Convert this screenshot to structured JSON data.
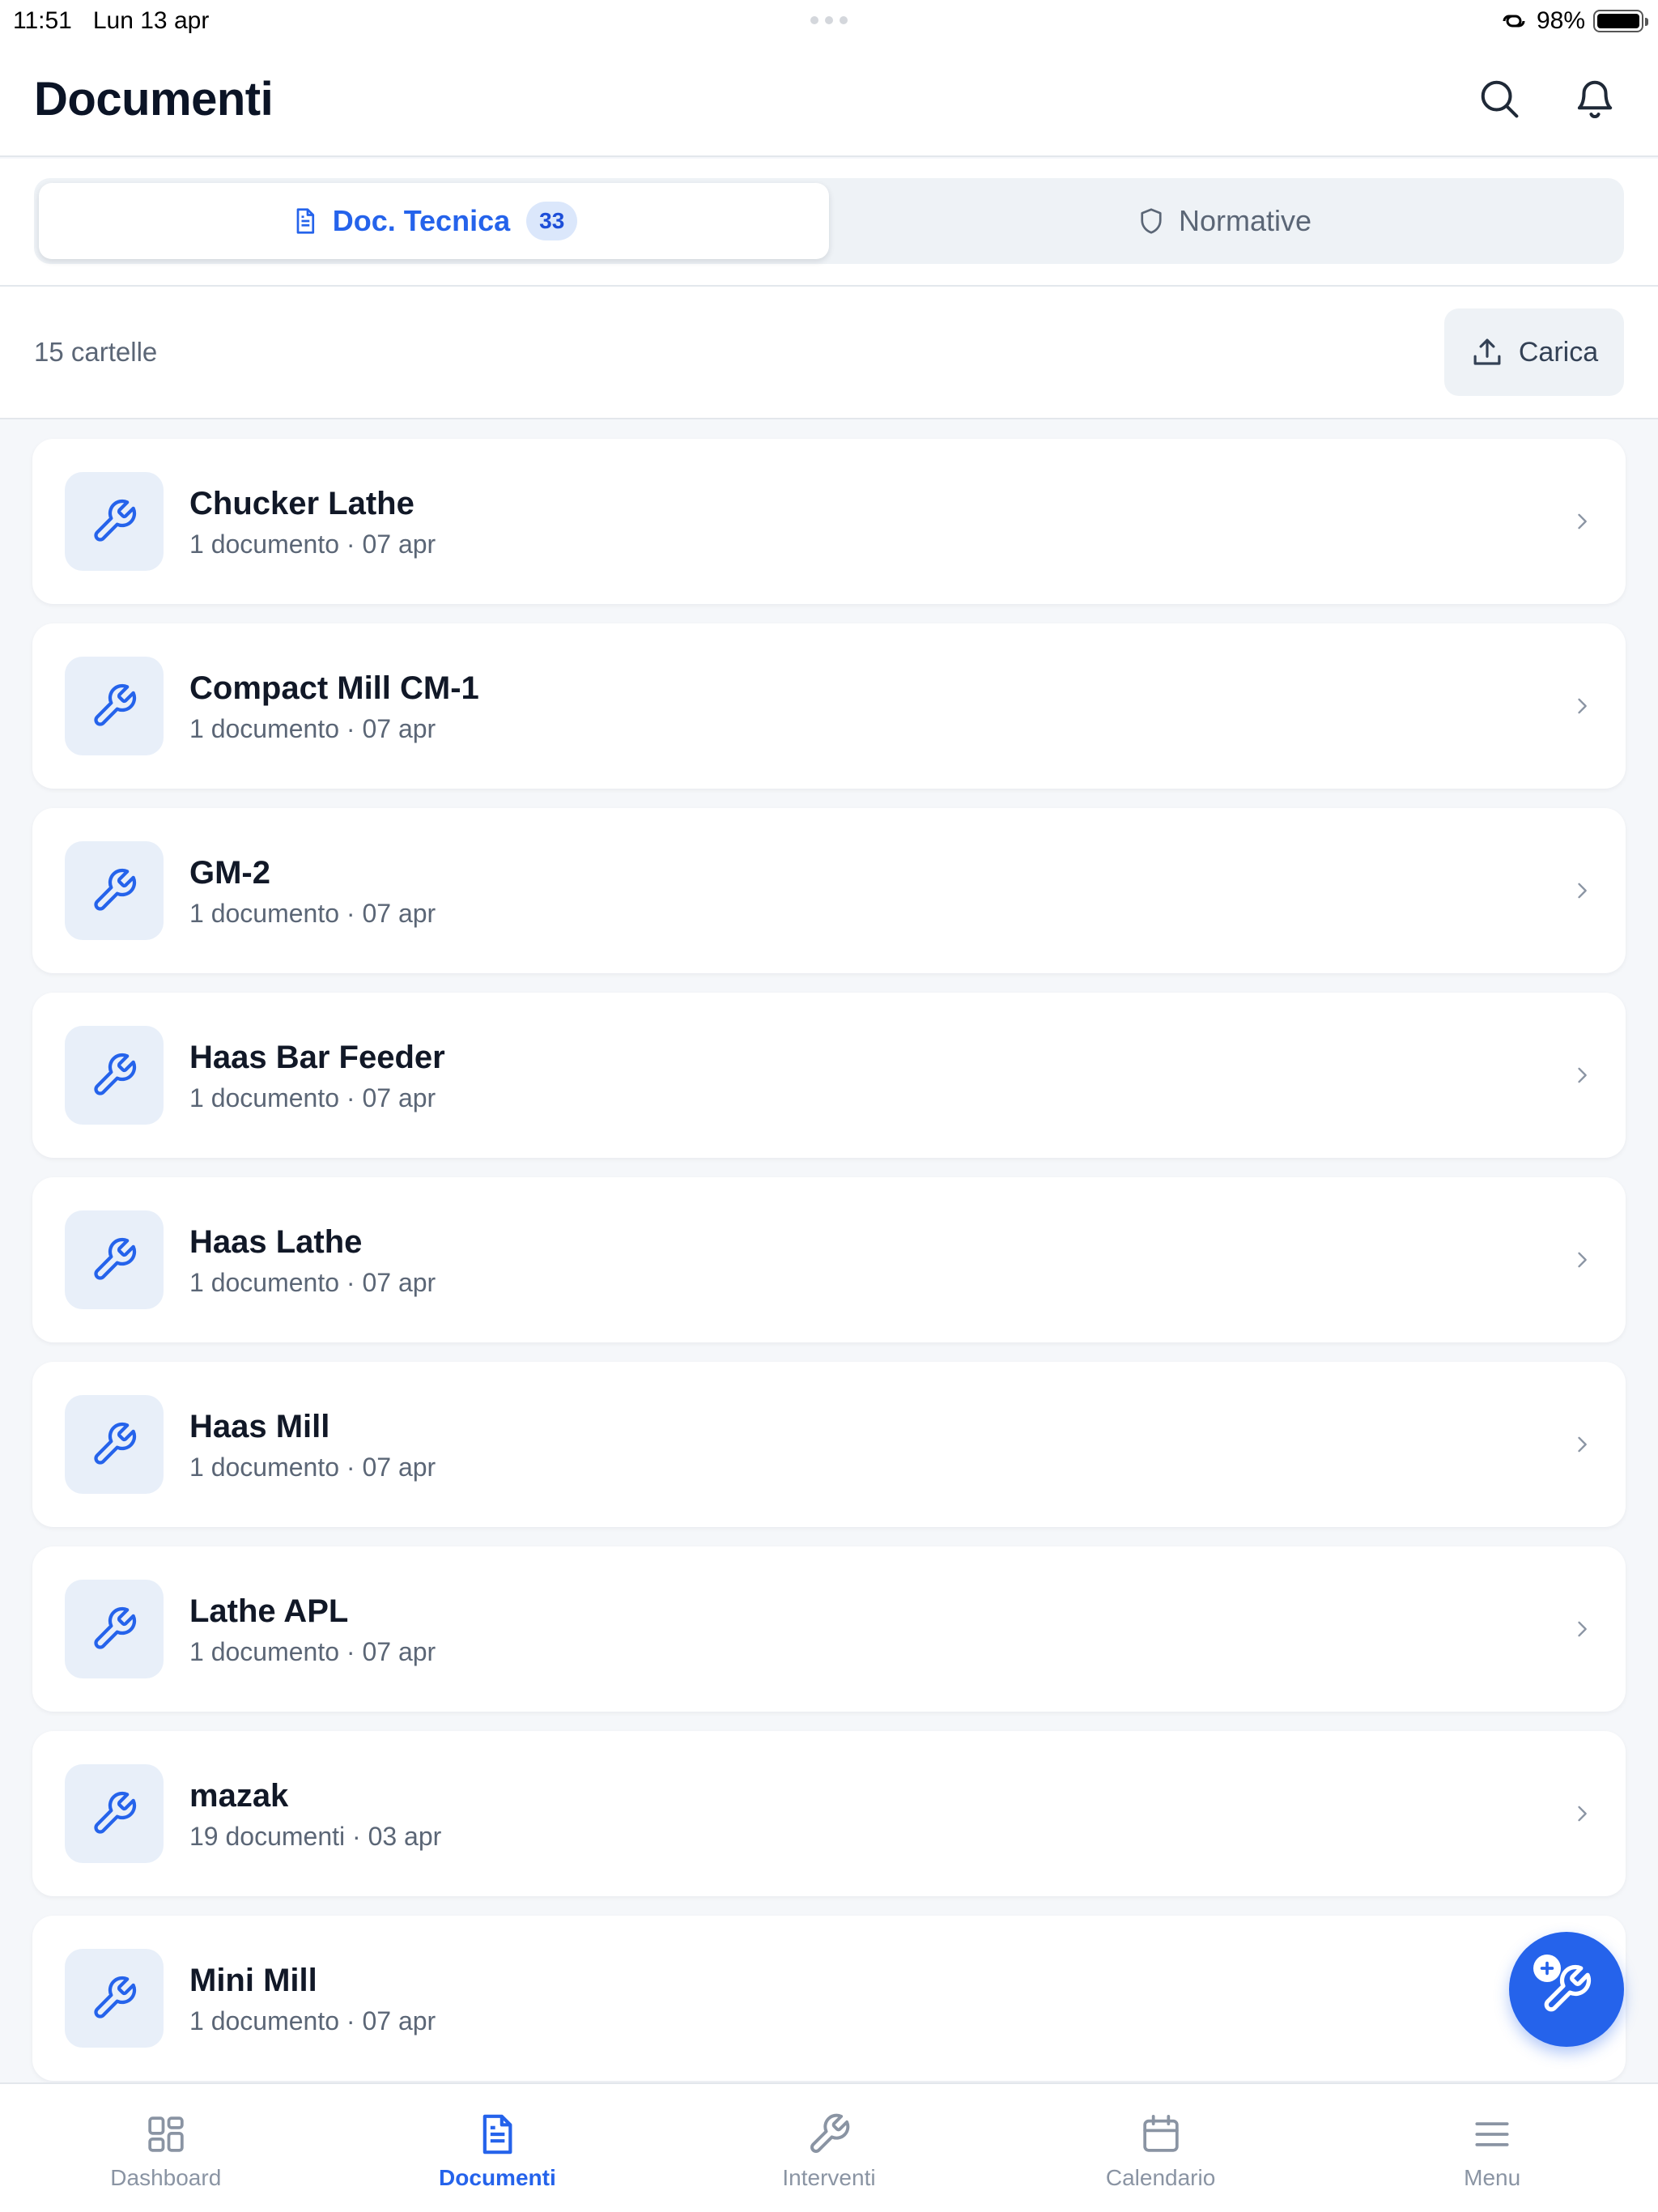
{
  "status_bar": {
    "time": "11:51",
    "date": "Lun 13 apr",
    "battery": "98%"
  },
  "header": {
    "title": "Documenti",
    "search_icon": "search-icon",
    "bell_icon": "bell-icon"
  },
  "tabs": [
    {
      "label": "Doc. Tecnica",
      "badge": "33",
      "icon": "document-icon",
      "active": true
    },
    {
      "label": "Normative",
      "icon": "shield-icon",
      "active": false
    }
  ],
  "toolbar": {
    "count_label": "15 cartelle",
    "upload_label": "Carica"
  },
  "folders": [
    {
      "name": "Chucker Lathe",
      "meta": "1 documento · 07 apr"
    },
    {
      "name": "Compact Mill CM-1",
      "meta": "1 documento · 07 apr"
    },
    {
      "name": "GM-2",
      "meta": "1 documento · 07 apr"
    },
    {
      "name": "Haas Bar Feeder",
      "meta": "1 documento · 07 apr"
    },
    {
      "name": "Haas Lathe",
      "meta": "1 documento · 07 apr"
    },
    {
      "name": "Haas Mill",
      "meta": "1 documento · 07 apr"
    },
    {
      "name": "Lathe APL",
      "meta": "1 documento · 07 apr"
    },
    {
      "name": "mazak",
      "meta": "19 documenti · 03 apr"
    },
    {
      "name": "Mini Mill",
      "meta": "1 documento · 07 apr"
    }
  ],
  "bottom_nav": [
    {
      "label": "Dashboard",
      "icon": "dashboard-icon",
      "active": false
    },
    {
      "label": "Documenti",
      "icon": "document-icon",
      "active": true
    },
    {
      "label": "Interventi",
      "icon": "wrench-icon",
      "active": false
    },
    {
      "label": "Calendario",
      "icon": "calendar-icon",
      "active": false
    },
    {
      "label": "Menu",
      "icon": "menu-icon",
      "active": false
    }
  ],
  "colors": {
    "accent": "#2563eb",
    "background": "#f5f7fa",
    "muted_text": "#5b6676"
  }
}
